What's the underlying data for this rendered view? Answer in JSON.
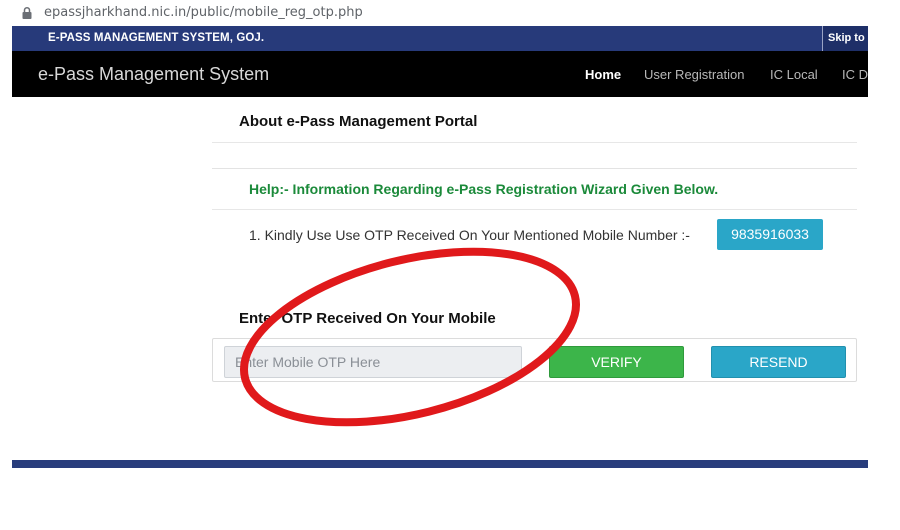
{
  "browser": {
    "url": "epassjharkhand.nic.in/public/mobile_reg_otp.php",
    "lock_icon": "lock-icon"
  },
  "header": {
    "gov_title": "E-PASS MANAGEMENT SYSTEM, GOJ.",
    "skip_label": "Skip to",
    "brand": "e-Pass Management System",
    "nav": [
      {
        "label": "Home",
        "active": true
      },
      {
        "label": "User Registration",
        "active": false
      },
      {
        "label": "IC Local",
        "active": false
      },
      {
        "label": "IC D",
        "active": false
      }
    ]
  },
  "main": {
    "about_title": "About e-Pass Management Portal",
    "help_text": "Help:- Information Regarding e-Pass Registration Wizard Given Below.",
    "instruction": "1. Kindly Use Use OTP Received On Your Mentioned Mobile Number :-",
    "mobile_number": "9835916033",
    "otp_title": "Enter OTP Received On Your Mobile",
    "otp_placeholder": "Enter Mobile OTP Here",
    "verify_label": "VERIFY",
    "resend_label": "RESEND"
  },
  "colors": {
    "gov_strip": "#273a7a",
    "navbar": "#000000",
    "help_green": "#1b8a3a",
    "verify_green": "#3cb54a",
    "info_blue": "#2aa6c8",
    "annotation_red": "#e0191b"
  }
}
